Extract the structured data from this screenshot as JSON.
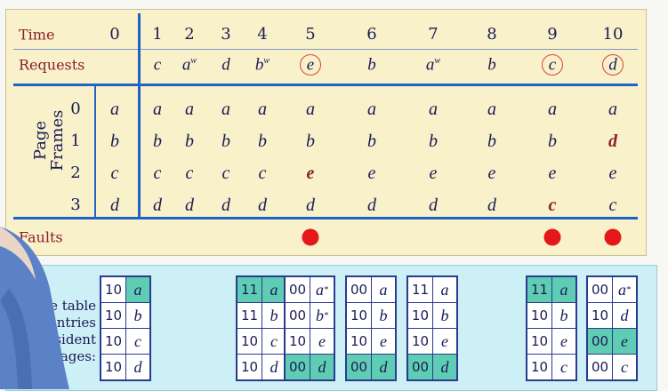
{
  "time_label": "Time",
  "requests_label": "Requests",
  "page_frames_label": [
    "Page",
    "Frames"
  ],
  "faults_label": "Faults",
  "page_table_label": [
    "ge table",
    "entries",
    "sident",
    "ages:"
  ],
  "times": [
    "0",
    "1",
    "2",
    "3",
    "4",
    "5",
    "6",
    "7",
    "8",
    "9",
    "10"
  ],
  "requests": [
    {
      "t": "1",
      "page": "c",
      "w": false,
      "fault": false
    },
    {
      "t": "2",
      "page": "a",
      "w": true,
      "fault": false
    },
    {
      "t": "3",
      "page": "d",
      "w": false,
      "fault": false
    },
    {
      "t": "4",
      "page": "b",
      "w": true,
      "fault": false
    },
    {
      "t": "5",
      "page": "e",
      "w": false,
      "fault": true
    },
    {
      "t": "6",
      "page": "b",
      "w": false,
      "fault": false
    },
    {
      "t": "7",
      "page": "a",
      "w": true,
      "fault": false
    },
    {
      "t": "8",
      "page": "b",
      "w": false,
      "fault": false
    },
    {
      "t": "9",
      "page": "c",
      "w": false,
      "fault": true
    },
    {
      "t": "10",
      "page": "d",
      "w": false,
      "fault": true
    }
  ],
  "write_mark": "w",
  "frame_indices": [
    "0",
    "1",
    "2",
    "3"
  ],
  "frames": [
    [
      "a",
      "a",
      "a",
      "a",
      "a",
      "a",
      "a",
      "a",
      "a",
      "a",
      "a"
    ],
    [
      "b",
      "b",
      "b",
      "b",
      "b",
      "b",
      "b",
      "b",
      "b",
      "b",
      "d"
    ],
    [
      "c",
      "c",
      "c",
      "c",
      "c",
      "e",
      "e",
      "e",
      "e",
      "e",
      "e"
    ],
    [
      "d",
      "d",
      "d",
      "d",
      "d",
      "d",
      "d",
      "d",
      "d",
      "c",
      "c"
    ]
  ],
  "new_frames": [
    [
      1,
      10
    ],
    [
      2,
      5
    ],
    [
      3,
      9
    ]
  ],
  "faults_at": [
    5,
    9,
    10
  ],
  "page_tables": [
    {
      "col": 0,
      "rows": [
        {
          "bits": "10",
          "page": "a",
          "star": false,
          "hl": "page"
        },
        {
          "bits": "10",
          "page": "b",
          "star": false,
          "hl": ""
        },
        {
          "bits": "10",
          "page": "c",
          "star": false,
          "hl": ""
        },
        {
          "bits": "10",
          "page": "d",
          "star": false,
          "hl": ""
        }
      ]
    },
    {
      "col": 4,
      "rows": [
        {
          "bits": "11",
          "page": "a",
          "star": false,
          "hl": "row"
        },
        {
          "bits": "11",
          "page": "b",
          "star": false,
          "hl": ""
        },
        {
          "bits": "10",
          "page": "c",
          "star": false,
          "hl": ""
        },
        {
          "bits": "10",
          "page": "d",
          "star": false,
          "hl": ""
        }
      ]
    },
    {
      "col": 5,
      "rows": [
        {
          "bits": "00",
          "page": "a",
          "star": true,
          "hl": ""
        },
        {
          "bits": "00",
          "page": "b",
          "star": true,
          "hl": ""
        },
        {
          "bits": "10",
          "page": "e",
          "star": false,
          "hl": ""
        },
        {
          "bits": "00",
          "page": "d",
          "star": false,
          "hl": "row"
        }
      ]
    },
    {
      "col": 6,
      "rows": [
        {
          "bits": "00",
          "page": "a",
          "star": false,
          "hl": ""
        },
        {
          "bits": "10",
          "page": "b",
          "star": false,
          "hl": ""
        },
        {
          "bits": "10",
          "page": "e",
          "star": false,
          "hl": ""
        },
        {
          "bits": "00",
          "page": "d",
          "star": false,
          "hl": "row"
        }
      ]
    },
    {
      "col": 7,
      "rows": [
        {
          "bits": "11",
          "page": "a",
          "star": false,
          "hl": ""
        },
        {
          "bits": "10",
          "page": "b",
          "star": false,
          "hl": ""
        },
        {
          "bits": "10",
          "page": "e",
          "star": false,
          "hl": ""
        },
        {
          "bits": "00",
          "page": "d",
          "star": false,
          "hl": "row"
        }
      ]
    },
    {
      "col": 9,
      "rows": [
        {
          "bits": "11",
          "page": "a",
          "star": false,
          "hl": "row"
        },
        {
          "bits": "10",
          "page": "b",
          "star": false,
          "hl": ""
        },
        {
          "bits": "10",
          "page": "e",
          "star": false,
          "hl": ""
        },
        {
          "bits": "10",
          "page": "c",
          "star": false,
          "hl": ""
        }
      ]
    },
    {
      "col": 10,
      "rows": [
        {
          "bits": "00",
          "page": "a",
          "star": true,
          "hl": ""
        },
        {
          "bits": "10",
          "page": "d",
          "star": false,
          "hl": ""
        },
        {
          "bits": "00",
          "page": "e",
          "star": false,
          "hl": "row"
        },
        {
          "bits": "00",
          "page": "c",
          "star": false,
          "hl": ""
        }
      ]
    }
  ],
  "colors": {
    "accent_blue": "#1f63c8",
    "fault_red": "#e4181b",
    "highlight_teal": "#5fcdb3",
    "label_maroon": "#8b1f2d"
  }
}
